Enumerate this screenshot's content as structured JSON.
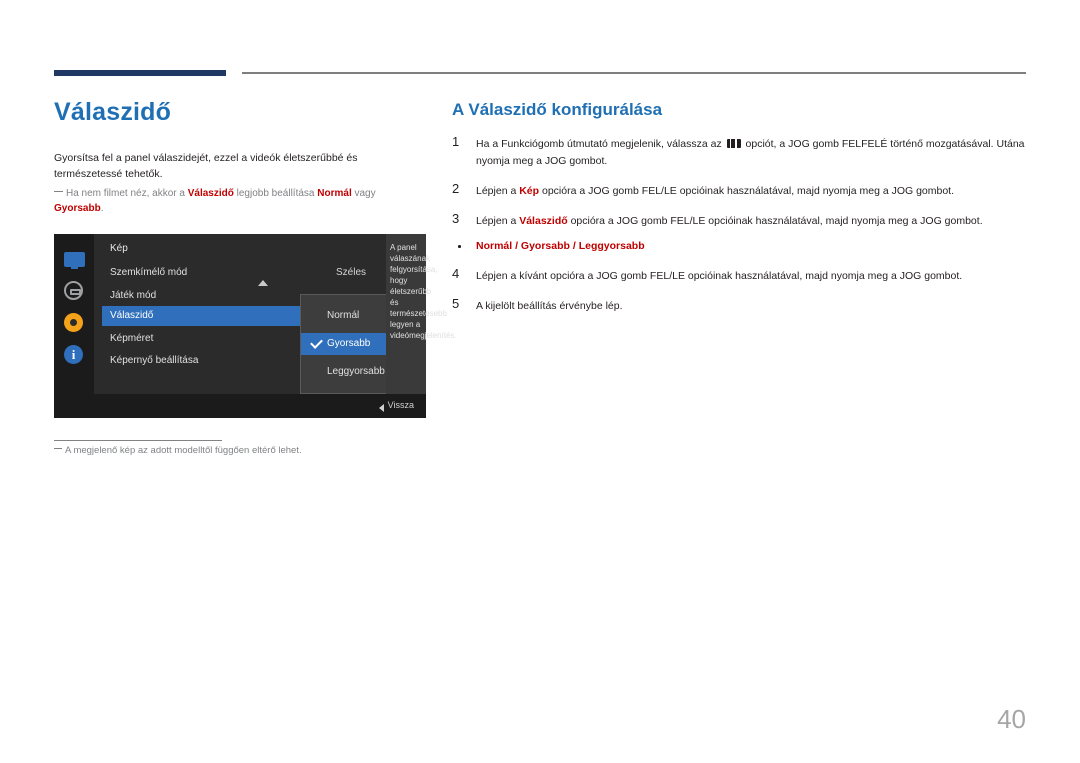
{
  "left": {
    "title": "Válaszidő",
    "intro": "Gyorsítsa fel a panel válaszidejét, ezzel a videók életszerűbbé és természetessé tehetők.",
    "note_pre": "Ha nem filmet néz, akkor a ",
    "note_b1": "Válaszidő",
    "note_mid": " legjobb beállítása ",
    "note_b2": "Normál",
    "note_mid2": " vagy ",
    "note_b3": "Gyorsabb",
    "note_end": ".",
    "footnote": "A megjelenő kép az adott modelltől függően eltérő lehet."
  },
  "osd": {
    "heading": "Kép",
    "rows": [
      {
        "label": "Szemkímélő mód",
        "value": "Széles"
      },
      {
        "label": "Játék mód",
        "value": ""
      },
      {
        "label": "Válaszidő",
        "value": ""
      },
      {
        "label": "Képméret",
        "value": ""
      },
      {
        "label": "Képernyő beállítása",
        "value": ""
      }
    ],
    "submenu": [
      {
        "label": "Normál",
        "checked": false
      },
      {
        "label": "Gyorsabb",
        "checked": true
      },
      {
        "label": "Leggyorsabb",
        "checked": false
      }
    ],
    "description": "A panel válaszának felgyorsítása, hogy életszerűbb és természetesebb legyen a videómegjelenítés.",
    "back_label": "Vissza",
    "icons": [
      "monitor-icon",
      "picture-mode-icon",
      "settings-gear-icon",
      "information-icon"
    ]
  },
  "right": {
    "title": "A Válaszidő konfigurálása",
    "steps": [
      {
        "num": "1",
        "pre": "Ha a Funkciógomb útmutató megjelenik, válassza az ",
        "glyph": true,
        "post": " opciót, a JOG gomb FELFELÉ történő mozgatásával. Utána nyomja meg a JOG gombot."
      },
      {
        "num": "2",
        "pre": "Lépjen a ",
        "bold": "Kép",
        "post": " opcióra a JOG gomb FEL/LE opcióinak használatával, majd nyomja meg a JOG gombot."
      },
      {
        "num": "3",
        "pre": "Lépjen a ",
        "bold": "Válaszidő",
        "post": " opcióra a JOG gomb FEL/LE opcióinak használatával, majd nyomja meg a JOG gombot."
      },
      {
        "num": "4",
        "pre": "Lépjen a kívánt opcióra a JOG gomb FEL/LE opcióinak használatával, majd nyomja meg a JOG gombot.",
        "post": ""
      },
      {
        "num": "5",
        "pre": "A kijelölt beállítás érvénybe lép.",
        "post": ""
      }
    ],
    "bullet": "Normál / Gyorsabb / Leggyorsabb"
  },
  "page_number": "40",
  "colors": {
    "accent_blue": "#1f6fb4",
    "rule_blue": "#1f3864",
    "highlight_red": "#c00000",
    "osd_select": "#2f6fbb",
    "muted": "#808285"
  }
}
